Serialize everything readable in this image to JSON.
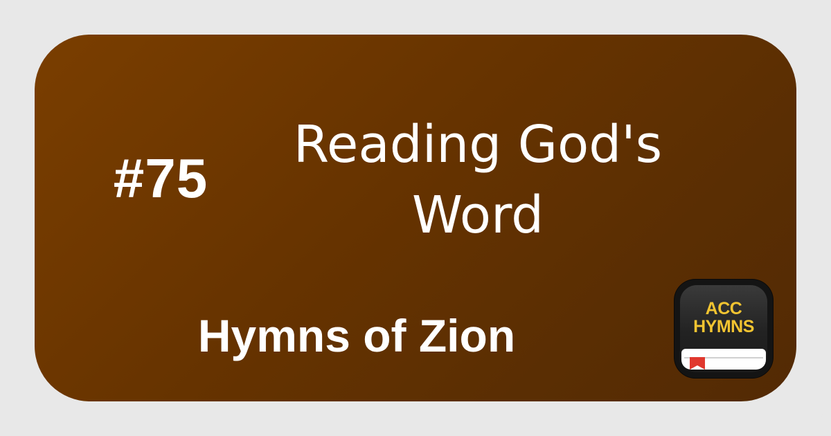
{
  "card": {
    "number": "#75",
    "title_line_1": "Reading God's",
    "title_line_2": "Word",
    "book_name": "Hymns of Zion"
  },
  "logo": {
    "line_1": "ACC",
    "line_2": "HYMNS",
    "icon": "bible-book-icon",
    "bookmark_icon": "bookmark-icon"
  },
  "colors": {
    "card_gradient_start": "#7a3e00",
    "card_gradient_end": "#532a04",
    "frame": "#e8e8e8",
    "text": "#ffffff",
    "logo_gold": "#f2c431",
    "logo_bookmark": "#e0382e"
  }
}
